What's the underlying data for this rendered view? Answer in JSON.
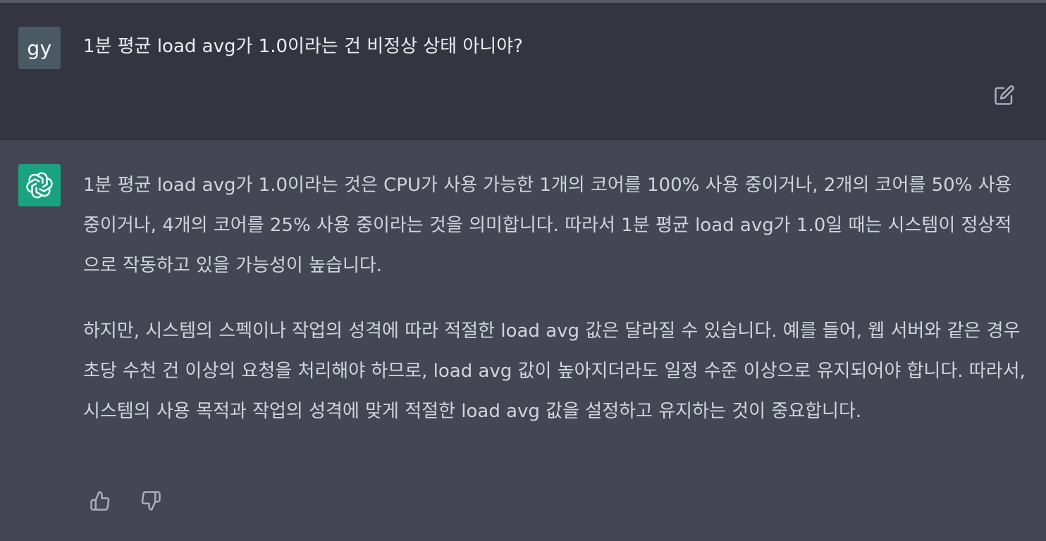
{
  "user": {
    "avatar_initials": "gy",
    "message": "1분 평균 load avg가 1.0이라는 건 비정상 상태 아니야?"
  },
  "assistant": {
    "paragraphs": [
      "1분 평균 load avg가 1.0이라는 것은 CPU가 사용 가능한 1개의 코어를 100% 사용 중이거나, 2개의 코어를 50% 사용 중이거나, 4개의 코어를 25% 사용 중이라는 것을 의미합니다. 따라서 1분 평균 load avg가 1.0일 때는 시스템이 정상적으로 작동하고 있을 가능성이 높습니다.",
      "하지만, 시스템의 스펙이나 작업의 성격에 따라 적절한 load avg 값은 달라질 수 있습니다. 예를 들어, 웹 서버와 같은 경우 초당 수천 건 이상의 요청을 처리해야 하므로, load avg 값이 높아지더라도 일정 수준 이상으로 유지되어야 합니다. 따라서, 시스템의 사용 목적과 작업의 성격에 맞게 적절한 load avg 값을 설정하고 유지하는 것이 중요합니다."
    ]
  },
  "icons": {
    "edit": "edit-icon",
    "assistant_logo": "openai-logo-icon",
    "thumbs_up": "thumbs-up-icon",
    "thumbs_down": "thumbs-down-icon"
  },
  "colors": {
    "user_row_bg": "#343541",
    "assistant_row_bg": "#444654",
    "user_avatar_bg": "#4a5a64",
    "assistant_avatar_bg": "#19a37f"
  }
}
